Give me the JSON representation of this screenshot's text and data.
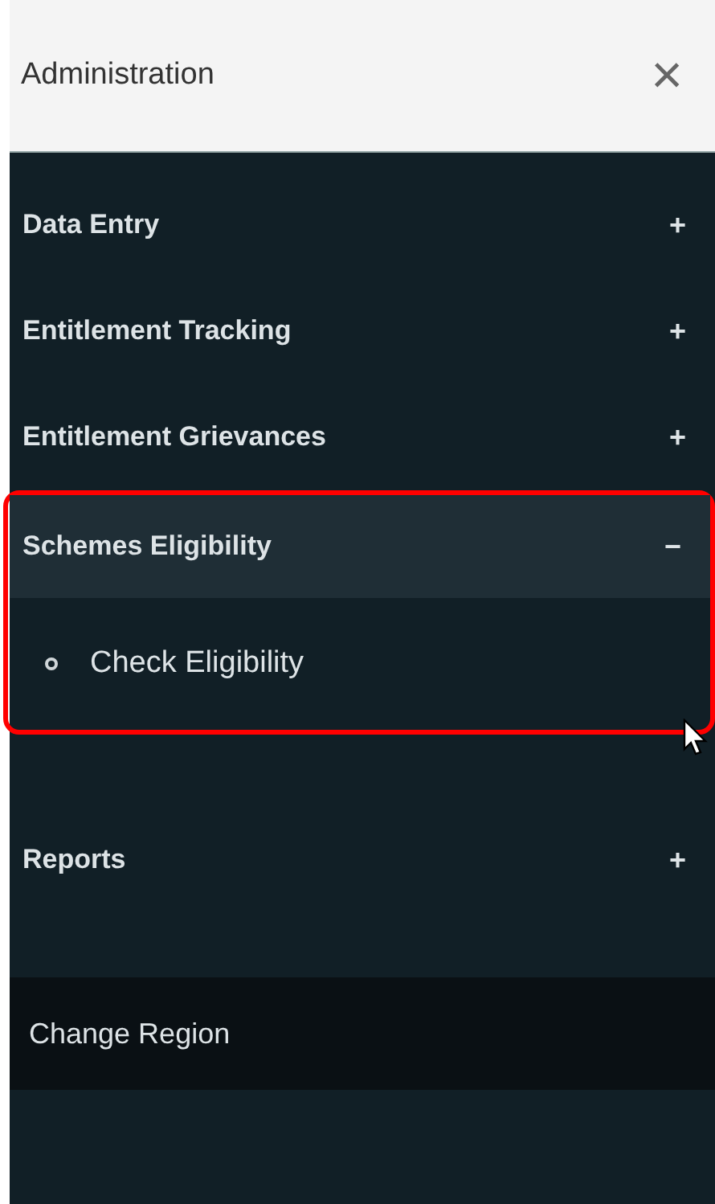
{
  "header": {
    "title": "Administration",
    "close": "×"
  },
  "menu": [
    {
      "label": "Data Entry",
      "sign": "+",
      "expanded": false,
      "highlighted": false
    },
    {
      "label": "Entitlement Tracking",
      "sign": "+",
      "expanded": false,
      "highlighted": false
    },
    {
      "label": "Entitlement Grievances",
      "sign": "+",
      "expanded": false,
      "highlighted": false
    },
    {
      "label": "Schemes Eligibility",
      "sign": "−",
      "expanded": true,
      "highlighted": true,
      "children": [
        {
          "label": "Check Eligibility"
        }
      ]
    },
    {
      "label": "Reports",
      "sign": "+",
      "expanded": false,
      "highlighted": false
    }
  ],
  "footer_link": "Change Region"
}
